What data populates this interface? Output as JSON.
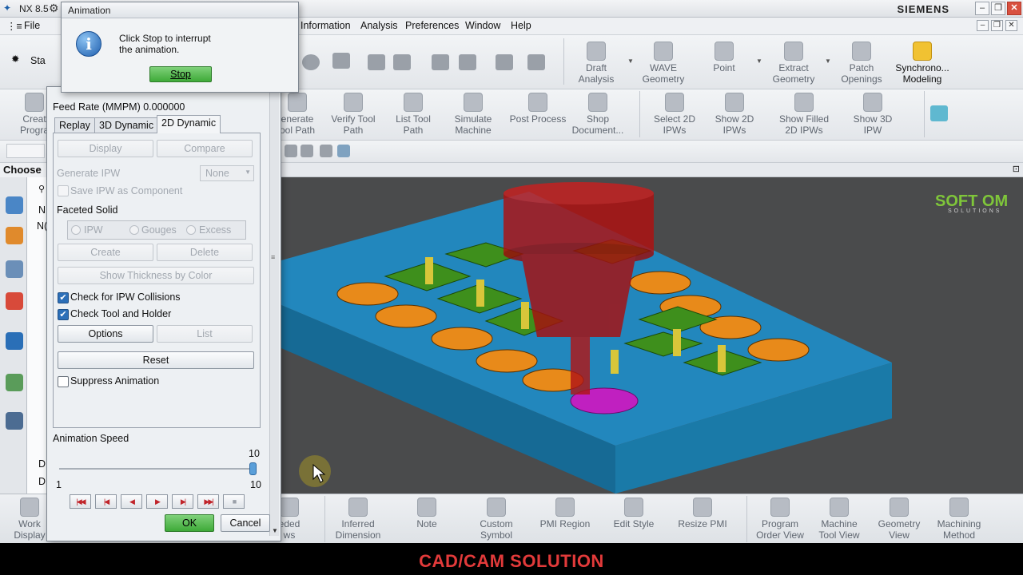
{
  "app": {
    "title": "NX 8.5",
    "brand": "SIEMENS",
    "menus": [
      "Information",
      "Analysis",
      "Preferences",
      "Window",
      "Help"
    ],
    "file_menu": "File",
    "start_label": "Sta",
    "choose_label": "Choose"
  },
  "toolbar_top": [
    {
      "label": "Draft\nAnalysis"
    },
    {
      "label": "WAVE\nGeometry"
    },
    {
      "label": "Point"
    },
    {
      "label": "Extract\nGeometry"
    },
    {
      "label": "Patch\nOpenings"
    },
    {
      "label": "Synchrono...\nModeling"
    }
  ],
  "toolbar_mfg": [
    {
      "label": "Creat\nProgra"
    },
    {
      "label": "enerate\nool Path"
    },
    {
      "label": "Verify Tool\nPath"
    },
    {
      "label": "List Tool\nPath"
    },
    {
      "label": "Simulate\nMachine"
    },
    {
      "label": "Post Process"
    },
    {
      "label": "Shop\nDocument..."
    },
    {
      "label": "Select 2D\nIPWs"
    },
    {
      "label": "Show 2D\nIPWs"
    },
    {
      "label": "Show Filled\n2D IPWs"
    },
    {
      "label": "Show 3D\nIPW"
    }
  ],
  "toolbar_bottom": [
    {
      "label": "Work\nDisplay"
    },
    {
      "label": "eded\nws"
    },
    {
      "label": "Inferred\nDimension"
    },
    {
      "label": "Note"
    },
    {
      "label": "Custom\nSymbol"
    },
    {
      "label": "PMI Region"
    },
    {
      "label": "Edit Style"
    },
    {
      "label": "Resize PMI"
    },
    {
      "label": "Program\nOrder View"
    },
    {
      "label": "Machine\nTool View"
    },
    {
      "label": "Geometry\nView"
    },
    {
      "label": "Machining\nMethod"
    }
  ],
  "navigator": {
    "rows": [
      "N",
      "N(",
      "D",
      "D"
    ]
  },
  "animation_popup": {
    "title": "Animation",
    "message": "Click Stop to interrupt\nthe animation.",
    "stop_label": "Stop"
  },
  "verify_dialog": {
    "feed_rate": "Feed Rate (MMPM) 0.000000",
    "tabs": [
      "Replay",
      "3D Dynamic",
      "2D Dynamic"
    ],
    "active_tab": "2D Dynamic",
    "display_label": "Display",
    "compare_label": "Compare",
    "generate_ipw_label": "Generate IPW",
    "generate_ipw_value": "None",
    "save_ipw_label": "Save IPW as Component",
    "faceted_solid_label": "Faceted Solid",
    "radio_options": [
      "IPW",
      "Gouges",
      "Excess"
    ],
    "create_label": "Create",
    "delete_label": "Delete",
    "show_thickness_label": "Show Thickness by Color",
    "check_ipw_collisions": {
      "label": "Check for IPW Collisions",
      "checked": true
    },
    "check_tool_holder": {
      "label": "Check Tool and Holder",
      "checked": true
    },
    "options_label": "Options",
    "list_label": "List",
    "reset_label": "Reset",
    "suppress_animation": {
      "label": "Suppress Animation",
      "checked": false
    },
    "animation_speed_label": "Animation Speed",
    "speed_value": "10",
    "speed_min": "1",
    "speed_max": "10",
    "speed_fraction": 1.0,
    "ok_label": "OK",
    "cancel_label": "Cancel"
  },
  "viewport": {
    "logo_text": "SOFT OM",
    "logo_sub": "SOLUTIONS"
  },
  "footer_caption": "CAD/CAM SOLUTION",
  "colors": {
    "viewport_bg": "#4a4b4c",
    "part_blue": "#1f7fb0",
    "pocket_orange": "#e88a1a",
    "boss_green": "#3e8f1c",
    "tool_red": "#b01010",
    "gouge_magenta": "#c020c0",
    "caption_red": "#e23a3a"
  }
}
